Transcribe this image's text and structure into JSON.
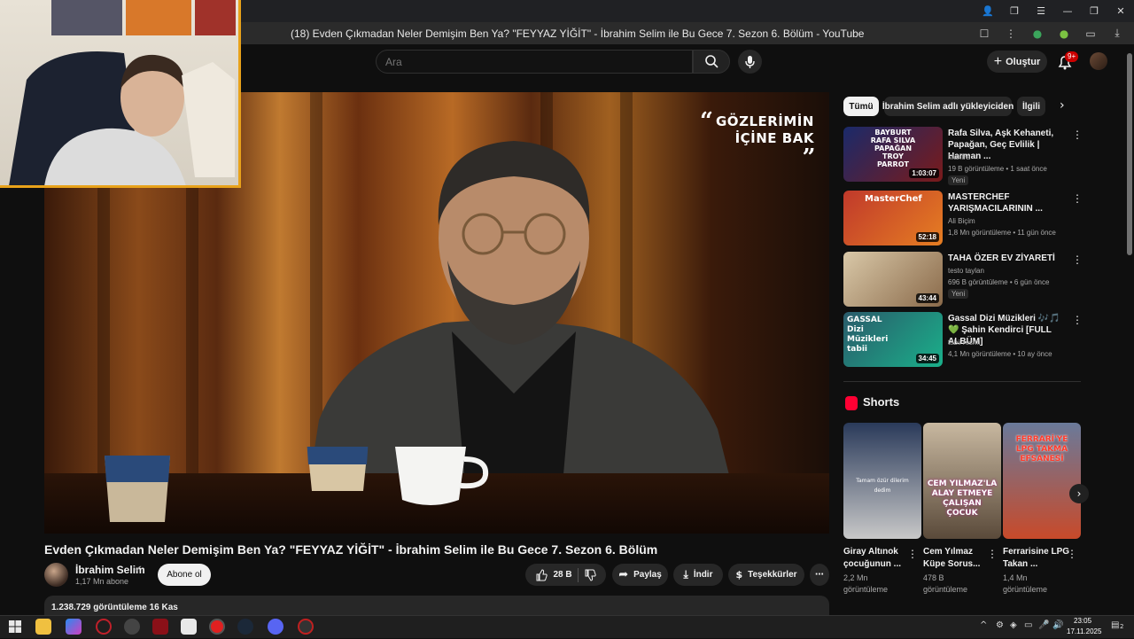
{
  "browser": {
    "page_title": "(18) Evden Çıkmadan Neler Demişim Ben Ya? \"FEYYAZ YİĞİT\" - İbrahim Selim ile Bu Gece 7. Sezon 6. Bölüm - YouTube"
  },
  "header": {
    "search_placeholder": "Ara",
    "create_label": "Oluştur",
    "notification_count": "9+"
  },
  "player": {
    "overlay_line1": "GÖZLERİMİN",
    "overlay_line2": "İÇİNE BAK",
    "quote_open": "“",
    "quote_close": "„"
  },
  "video": {
    "title": "Evden Çıkmadan Neler Demişim Ben Ya? \"FEYYAZ YİĞİT\" - İbrahim Selim ile Bu Gece 7. Sezon 6. Bölüm",
    "channel": "İbrahim Selim",
    "subscribers": "1,17 Mn abone",
    "subscribe_label": "Abone ol",
    "likes": "28 B",
    "share_label": "Paylaş",
    "download_label": "İndir",
    "thanks_label": "Teşekkürler",
    "views_date": "1.238.729 görüntüleme  16 Kas"
  },
  "chips": [
    "Tümü",
    "İbrahim Selim adlı yükleyiciden",
    "İlgili"
  ],
  "recommendations": [
    {
      "title": "Rafa Silva, Aşk Kehaneti, Papağan, Geç Evlilik | Harman ...",
      "channel": "Mantra",
      "meta": "19 B görüntüleme • 1 saat önce",
      "badge": "Yeni",
      "duration": "1:03:07",
      "thumb_text": "BAYBURT RAFA SILVA PAPAĞAN TROY PARROT"
    },
    {
      "title": "MASTERCHEF YARIŞMACILARININ ...",
      "channel": "Ali Biçim",
      "meta": "1,8 Mn görüntüleme • 11 gün önce",
      "badge": "",
      "duration": "52:18",
      "thumb_text": "MasterChef"
    },
    {
      "title": "TAHA ÖZER EV ZİYARETİ",
      "channel": "testo taylan",
      "meta": "696 B görüntüleme • 6 gün önce",
      "badge": "Yeni",
      "duration": "43:44",
      "thumb_text": ""
    },
    {
      "title": "Gassal Dizi Müzikleri 🎶🎵💚 Şahin Kendirci [FULL ALBÜM]",
      "channel": "tabii resmi",
      "meta": "4,1 Mn görüntüleme • 10 ay önce",
      "badge": "",
      "duration": "34:45",
      "thumb_text": "GASSAL Dizi Müzikleri tabii"
    }
  ],
  "shorts": {
    "section_title": "Shorts",
    "items": [
      {
        "title": "Giray Altınok çocuğunun ...",
        "views": "2,2 Mn görüntüleme",
        "thumb_text": "Tamam özür dilerim dedim"
      },
      {
        "title": "Cem Yılmaz Küpe Sorus...",
        "views": "478 B görüntüleme",
        "thumb_text": "CEM YILMAZ'LA ALAY ETMEYE ÇALIŞAN ÇOCUK"
      },
      {
        "title": "Ferrarisine LPG Takan ...",
        "views": "1,4 Mn görüntüleme",
        "thumb_text": "FERRARİ'YE LPG TAKMA EFSANESİ"
      }
    ]
  },
  "taskbar": {
    "time": "23:05",
    "date": "17.11.2025",
    "notif_count": "2"
  },
  "colors": {
    "youtube_red": "#ff0033",
    "background": "#0f0f0f",
    "webcam_border": "#e8a21a"
  }
}
